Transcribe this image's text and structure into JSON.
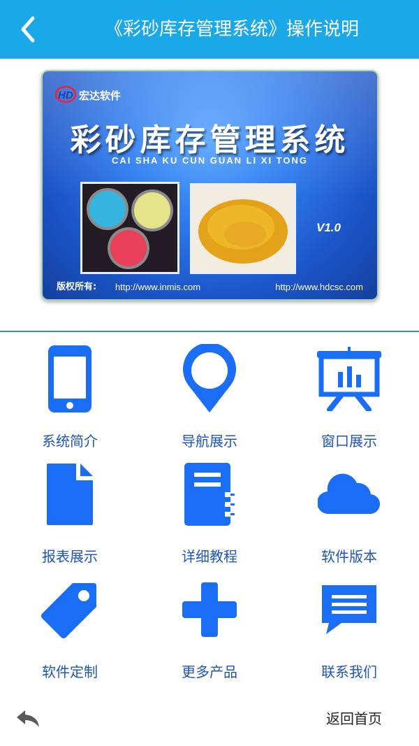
{
  "header": {
    "title": "《彩砂库存管理系统》操作说明",
    "back_icon": "chevron-left-icon"
  },
  "banner": {
    "logo_text": "宏达软件",
    "title": "彩砂库存管理系统",
    "subtitle": "CAI SHA KU CUN GUAN LI XI TONG",
    "version": "V1.0",
    "copyright_label": "版权所有:",
    "url_left": "http://www.inmis.com",
    "url_right": "http://www.hdcsc.com"
  },
  "menu": [
    {
      "label": "系统简介",
      "icon": "phone-icon"
    },
    {
      "label": "导航展示",
      "icon": "map-pin-icon"
    },
    {
      "label": "窗口展示",
      "icon": "presentation-chart-icon"
    },
    {
      "label": "报表展示",
      "icon": "document-icon"
    },
    {
      "label": "详细教程",
      "icon": "notebook-icon"
    },
    {
      "label": "软件版本",
      "icon": "cloud-icon"
    },
    {
      "label": "软件定制",
      "icon": "tag-icon"
    },
    {
      "label": "更多产品",
      "icon": "plus-icon"
    },
    {
      "label": "联系我们",
      "icon": "message-icon"
    }
  ],
  "footer": {
    "back_icon": "reply-arrow-icon",
    "home_label": "返回首页"
  },
  "colors": {
    "header_bg": "#1aa8e8",
    "icon_blue": "#1a6ef5",
    "label_blue": "#1f55b8"
  }
}
